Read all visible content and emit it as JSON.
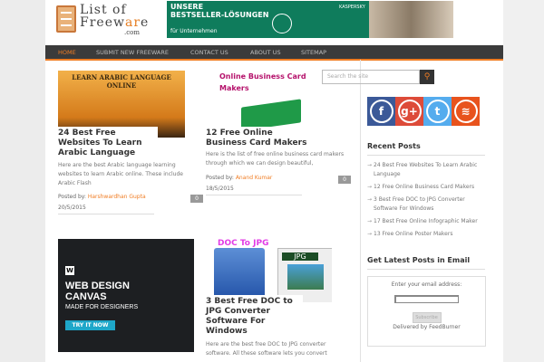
{
  "header": {
    "logo": {
      "line1": "List of",
      "line2_pre": "Freew",
      "line2_accent": "ar",
      "line2_post": "e",
      "domain": ".com"
    },
    "ad": {
      "headline1": "UNSERE",
      "headline2": "BESTSELLER-LÖSUNGEN",
      "sub": "für Unternehmen",
      "brand": "KASPERSKY"
    }
  },
  "nav": [
    "HOME",
    "SUBMIT NEW FREEWARE",
    "CONTACT US",
    "ABOUT US",
    "SITEMAP"
  ],
  "posts": [
    {
      "img_text": "LEARN ARABIC LANGUAGE ONLINE",
      "title": "24 Best Free Websites To Learn Arabic Language",
      "excerpt": "Here are the best Arabic language learning websites to learn Arabic online. These include Arabic Flash",
      "posted_by": "Posted by:",
      "author": "Harshwardhan Gupta",
      "date": "20/5/2015",
      "comments": "0"
    },
    {
      "img_text": "Online Business Card Makers",
      "title": "12 Free Online Business Card Makers",
      "excerpt": "Here is the list of free online business card makers through which we can design beautiful,",
      "posted_by": "Posted by:",
      "author": "Anand Kumar",
      "date": "18/5/2015",
      "comments": "0"
    },
    {
      "img_text": "DOC To JPG",
      "img_badge": "JPG",
      "title": "3 Best Free DOC to JPG Converter Software For Windows",
      "excerpt": "Here are the best free DOC to JPG converter software. All these software lets you convert"
    }
  ],
  "ad2": {
    "logo": "W",
    "headline": "WEB DESIGN CANVAS",
    "sub": "MADE FOR DESIGNERS",
    "cta": "TRY IT NOW"
  },
  "sidebar": {
    "search_placeholder": "Search the site",
    "social": [
      "facebook",
      "google-plus",
      "twitter",
      "rss"
    ],
    "social_colors": [
      "#3b5998",
      "#dd4b39",
      "#55acee",
      "#e8531d"
    ],
    "recent_title": "Recent Posts",
    "recent": [
      "24 Best Free Websites To Learn Arabic Language",
      "12 Free Online Business Card Makers",
      "3 Best Free DOC to JPG Converter Software For Windows",
      "17 Best Free Online Infographic Maker",
      "13 Free Online Poster Makers"
    ],
    "email_title": "Get Latest Posts in Email",
    "email_label": "Enter your email address:",
    "subscribe": "Subscribe",
    "delivered": "Delivered by FeedBurner"
  }
}
